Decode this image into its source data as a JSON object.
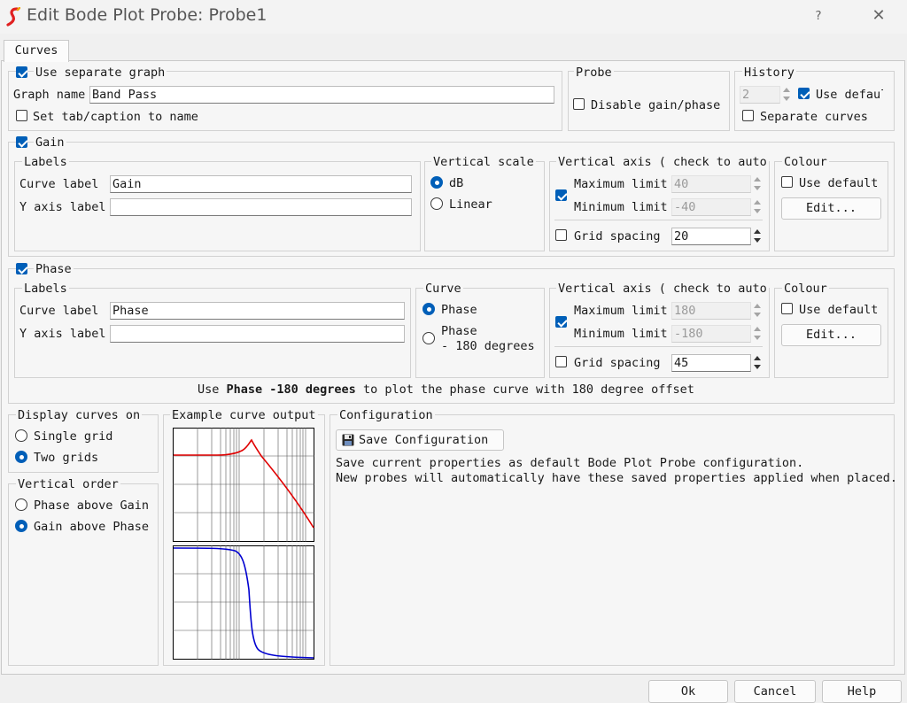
{
  "window": {
    "title": "Edit Bode Plot Probe: Probe1",
    "help": "?",
    "close": "✕"
  },
  "tabs": [
    {
      "label": "Curves"
    }
  ],
  "graph": {
    "use_separate_label": "Use separate graph",
    "use_separate_checked": true,
    "name_label": "Graph name",
    "name_value": "Band Pass",
    "set_tab_label": "Set tab/caption to name",
    "set_tab_checked": false
  },
  "probe": {
    "title": "Probe",
    "disable_label": "Disable gain/phase",
    "disable_checked": false
  },
  "history": {
    "title": "History",
    "value": "2",
    "use_default_label": "Use defaul",
    "use_default_checked": true,
    "separate_label": "Separate curves",
    "separate_checked": false
  },
  "gain": {
    "title": "Gain",
    "checked": true,
    "labels_title": "Labels",
    "curve_label_label": "Curve label",
    "curve_label_value": "Gain",
    "y_axis_label": "Y axis label",
    "y_axis_value": "",
    "vscale_title": "Vertical scale",
    "db_label": "dB",
    "linear_label": "Linear",
    "selected": "dB",
    "vaxis_title": "Vertical axis ( check to auto",
    "max_label": "Maximum limit",
    "max_value": "40",
    "min_label": "Minimum limit",
    "min_value": "-40",
    "auto_checked": true,
    "grid_label": "Grid spacing",
    "grid_value": "20",
    "grid_checked": false,
    "colour_title": "Colour",
    "use_default_label": "Use default",
    "use_default_checked": false,
    "edit_label": "Edit..."
  },
  "phase": {
    "title": "Phase",
    "checked": true,
    "labels_title": "Labels",
    "curve_label_label": "Curve label",
    "curve_label_value": "Phase",
    "y_axis_label": "Y axis label",
    "y_axis_value": "",
    "curve_title": "Curve",
    "phase_label": "Phase",
    "phase180_line1": "Phase",
    "phase180_line2": "- 180 degrees",
    "selected": "Phase",
    "vaxis_title": "Vertical axis ( check to auto",
    "max_label": "Maximum limit",
    "max_value": "180",
    "min_label": "Minimum limit",
    "min_value": "-180",
    "auto_checked": true,
    "grid_label": "Grid spacing",
    "grid_value": "45",
    "grid_checked": false,
    "colour_title": "Colour",
    "use_default_label": "Use default",
    "use_default_checked": false,
    "edit_label": "Edit...",
    "hint_pre": "Use ",
    "hint_bold": "Phase -180 degrees",
    "hint_post": " to plot the phase curve with 180 degree offset"
  },
  "display": {
    "title": "Display curves on",
    "single_label": "Single grid",
    "two_label": "Two grids",
    "selected": "Two grids"
  },
  "vorder": {
    "title": "Vertical order",
    "phase_above_label": "Phase above Gain",
    "gain_above_label": "Gain above Phase",
    "selected": "Gain above Phase"
  },
  "example": {
    "title": "Example curve output"
  },
  "config": {
    "title": "Configuration",
    "save_label": "Save Configuration",
    "desc_line1": "Save current properties as default Bode Plot Probe configuration.",
    "desc_line2": "New probes will automatically have these saved properties applied when placed."
  },
  "footer": {
    "ok": "Ok",
    "cancel": "Cancel",
    "help": "Help"
  },
  "colors": {
    "gain_curve": "#e00000",
    "phase_curve": "#0000d0",
    "accent": "#005fb8"
  },
  "icons": {
    "app": "simetrix-logo-icon",
    "save": "floppy-disk-icon"
  }
}
